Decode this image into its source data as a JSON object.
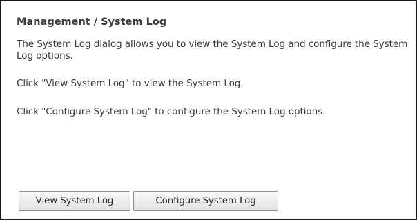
{
  "page": {
    "title": "Management / System Log",
    "description": "The System Log dialog allows you to view the System Log and configure the System Log options.",
    "view_hint": "Click \"View System Log\" to view the System Log.",
    "configure_hint": "Click \"Configure System Log\" to configure the System Log options."
  },
  "buttons": {
    "view_label": "View System Log",
    "configure_label": "Configure System Log"
  }
}
